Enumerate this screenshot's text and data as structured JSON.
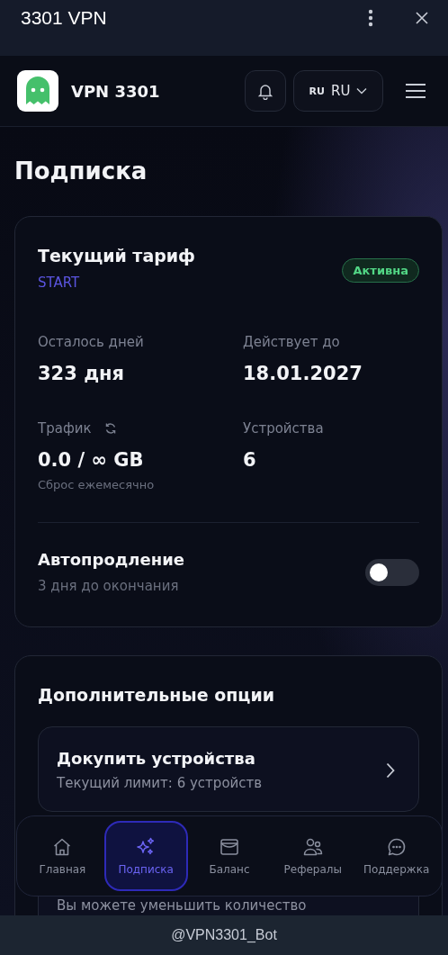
{
  "window": {
    "title": "3301 VPN"
  },
  "header": {
    "brand": "VPN 3301",
    "language": {
      "code": "RU",
      "label": "RU"
    }
  },
  "page_title": "Подписка",
  "plan_card": {
    "title": "Текущий тариф",
    "plan": "START",
    "status": {
      "label": "Активна",
      "active": true
    },
    "stats": [
      {
        "kind": "plain",
        "label": "Осталось дней",
        "value": "323 дня"
      },
      {
        "kind": "plain",
        "label": "Действует до",
        "value": "18.01.2027"
      },
      {
        "kind": "traffic",
        "label": "Трафик",
        "value": "0.0 / ∞ GB",
        "note": "Сброс ежемесячно"
      },
      {
        "kind": "plain",
        "label": "Устройства",
        "value": "6"
      }
    ],
    "auto_renew": {
      "title": "Автопродление",
      "note": "3 дня до окончания",
      "on": false
    }
  },
  "options_card": {
    "title": "Дополнительные опции",
    "items": [
      {
        "title": "Докупить устройства",
        "subtitle": "Текущий лимит: 6 устройств"
      },
      {
        "subtitle": "Вы можете уменьшить количество"
      }
    ]
  },
  "bottom_nav": [
    {
      "label": "Главная",
      "selected": false
    },
    {
      "label": "Подписка",
      "selected": true
    },
    {
      "label": "Баланс",
      "selected": false
    },
    {
      "label": "Рефералы",
      "selected": false
    },
    {
      "label": "Поддержка",
      "selected": false
    }
  ],
  "footer": {
    "bot": "@VPN3301_Bot"
  }
}
